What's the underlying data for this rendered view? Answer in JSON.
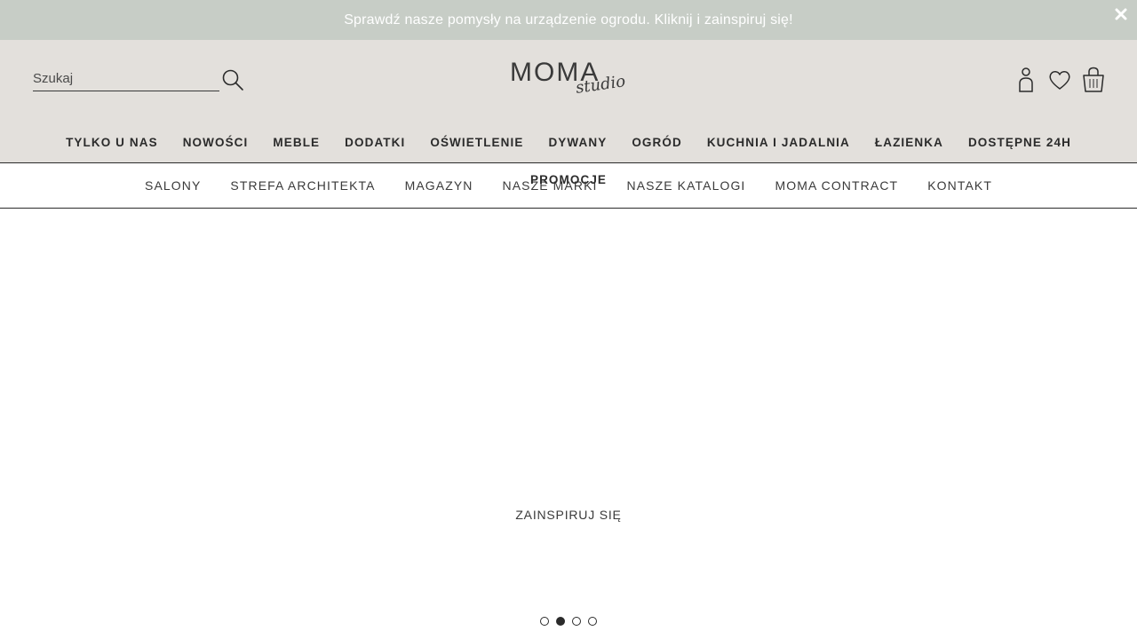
{
  "banner": {
    "text": "Sprawdź nasze pomysły na urządzenie ogrodu. Kliknij i zainspiruj się!",
    "close_icon": "close-icon"
  },
  "search": {
    "placeholder": "Szukaj",
    "value": "",
    "icon": "search-icon"
  },
  "logo": {
    "main": "MOMA",
    "script": "studio"
  },
  "header_icons": [
    "user-icon",
    "heart-icon",
    "shopping-bag-icon"
  ],
  "main_nav": [
    {
      "label": "TYLKO U NAS"
    },
    {
      "label": "NOWOŚCI"
    },
    {
      "label": "MEBLE"
    },
    {
      "label": "DODATKI"
    },
    {
      "label": "OŚWIETLENIE"
    },
    {
      "label": "DYWANY"
    },
    {
      "label": "OGRÓD"
    },
    {
      "label": "KUCHNIA I JADALNIA"
    },
    {
      "label": "ŁAZIENKA"
    },
    {
      "label": "DOSTĘPNE 24H"
    }
  ],
  "promo_label": "PROMOCJE",
  "sub_nav": [
    {
      "label": "SALONY"
    },
    {
      "label": "STREFA ARCHITEKTA"
    },
    {
      "label": "MAGAZYN"
    },
    {
      "label": "NASZE MARKI"
    },
    {
      "label": "NASZE KATALOGI"
    },
    {
      "label": "MOMA CONTRACT"
    },
    {
      "label": "KONTAKT"
    }
  ],
  "hero": {
    "cta": "ZAINSPIRUJ SIĘ",
    "slides_count": 4,
    "active_slide": 2
  },
  "colors": {
    "banner_bg": "#c7cdc6",
    "header_bg": "#e3e0dc",
    "text": "#2b2b2b"
  }
}
